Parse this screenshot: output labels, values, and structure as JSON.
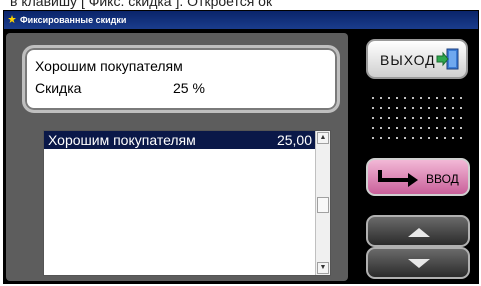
{
  "above_text": "в клавишу [ Фикс. скидка ]. Откроется ок",
  "window": {
    "title": "Фиксированные скидки"
  },
  "info": {
    "line1": "Хорошим покупателям",
    "label2": "Скидка",
    "value2": "25 %"
  },
  "list": {
    "rows": [
      {
        "name": "Хорошим покупателям",
        "value": "25,00"
      }
    ]
  },
  "buttons": {
    "exit_label": "ВЫХОД",
    "enter_label": "ВВОД"
  },
  "colors": {
    "selection": "#0a1848",
    "enter": "#c9609a",
    "panel": "#5d5d5d"
  }
}
